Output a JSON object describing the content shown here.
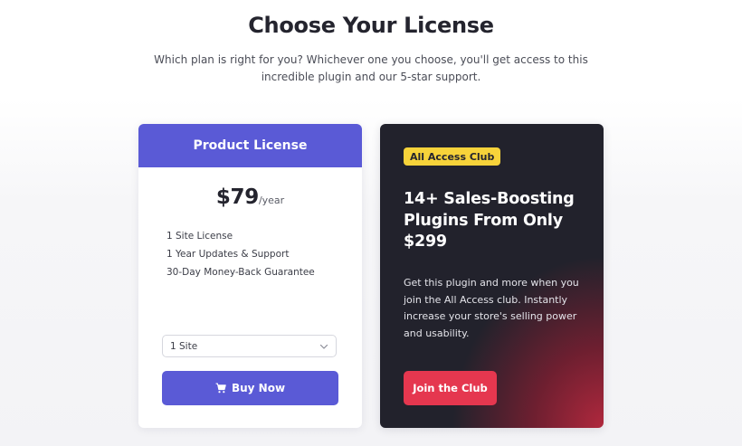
{
  "page": {
    "title": "Choose Your License",
    "subtitle": "Which plan is right for you? Whichever one you choose, you'll get access to this incredible plugin and our 5-star support."
  },
  "product_card": {
    "header": "Product License",
    "price": "$79",
    "period": "/year",
    "features": [
      "1 Site License",
      "1 Year Updates & Support",
      "30-Day Money-Back Guarantee"
    ],
    "select_value": "1 Site",
    "buy_label": "Buy Now"
  },
  "access_card": {
    "badge": "All Access Club",
    "heading": "14+ Sales-Boosting Plugins From Only $299",
    "description": "Get this plugin and more when you join the All Access club. Instantly increase your store's selling power and usability.",
    "join_label": "Join the Club"
  },
  "icons": {
    "cart": "shopping-cart-icon",
    "chevron": "chevron-down-icon"
  },
  "colors": {
    "primary": "#5a5ad6",
    "badge": "#f7d33a",
    "join": "#e5374f",
    "dark_card": "#22222c"
  }
}
